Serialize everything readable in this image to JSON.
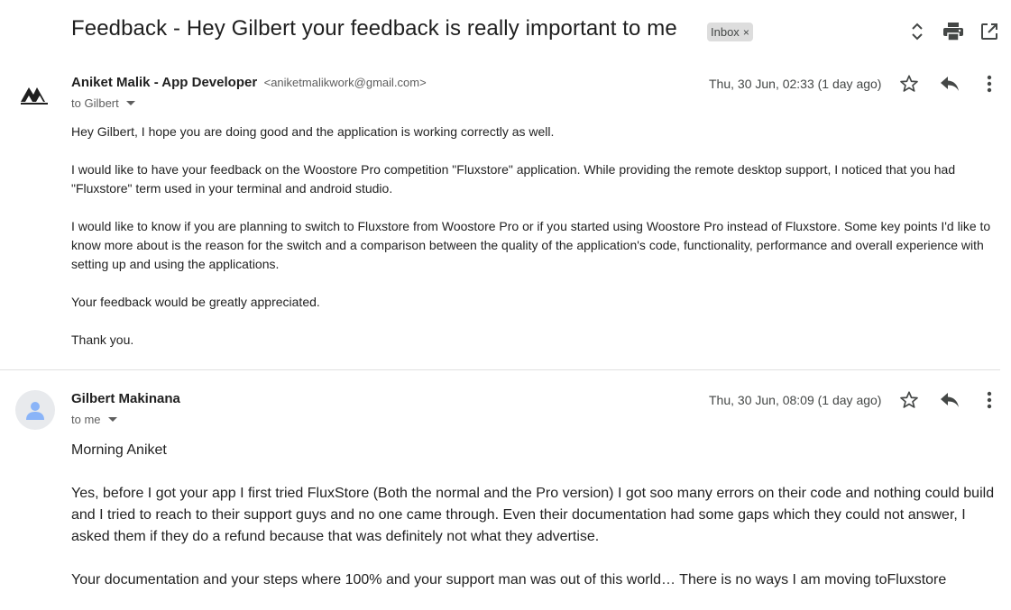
{
  "subject": "Feedback - Hey Gilbert your feedback is really important to me",
  "label": {
    "text": "Inbox",
    "remove": "×"
  },
  "toolbar": {
    "icons": [
      "expand-collapse-icon",
      "print-icon",
      "open-in-new-window-icon"
    ]
  },
  "messages": [
    {
      "sender_name": "Aniket Malik - App Developer",
      "sender_email": "<aniketmalikwork@gmail.com>",
      "to": "to Gilbert",
      "date": "Thu, 30 Jun, 02:33 (1 day ago)",
      "paragraphs": [
        "Hey Gilbert, I hope you are doing good and the application is working correctly as well.",
        "I would like to have your feedback on the Woostore Pro competition \"Fluxstore\" application. While providing the remote desktop support, I noticed that you had \"Fluxstore\" term used in your terminal and android studio.",
        "I would like to know if you are planning to switch to Fluxstore from Woostore Pro or if you started using Woostore Pro instead of Fluxstore. Some key points I'd like to know more about is the reason for the switch and a comparison between the quality of the application's code, functionality, performance and overall experience with setting up and using the applications.",
        "Your feedback would be greatly appreciated.",
        "Thank you."
      ]
    },
    {
      "sender_name": "Gilbert Makinana",
      "to": "to me",
      "date": "Thu, 30 Jun, 08:09 (1 day ago)",
      "paragraphs": [
        "Morning Aniket",
        "Yes, before I got your app I first tried FluxStore (Both the normal and the Pro version) I got soo many errors on their code and nothing could build and I tried to reach to their support guys and no one came through. Even their documentation had some gaps which they could not answer, I asked them if they do a refund because that was definitely not what they advertise.",
        "Your documentation and your steps where 100% and your support man was out of this world… There is no ways I am moving toFluxstore"
      ]
    }
  ],
  "colors": {
    "text": "#1f1f1f",
    "secondary": "#5e5e5e",
    "icon": "#444746",
    "label_bg": "#dddddd",
    "divider": "#e0e0e0",
    "avatar_bg": "#e8eaed",
    "avatar_fg": "#8ab4f8"
  }
}
